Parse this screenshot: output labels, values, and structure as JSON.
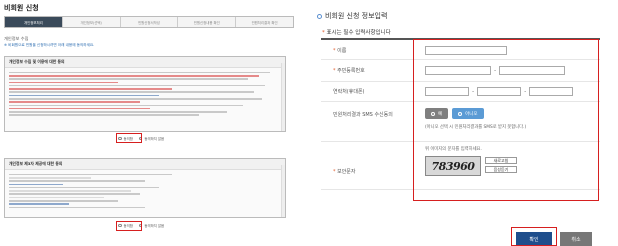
{
  "left": {
    "title": "비회원 신청",
    "tabs": [
      "개인정보처리",
      "개인정보(선택)",
      "민원신청서작성",
      "민원신청내용 확인",
      "민원처리결과 확인"
    ],
    "section_title": "개인정보 수집",
    "note": "※ 비회원으로 민원을 신청하시려면 아래 내용에 동의하세요.",
    "box1_head": "개인정보 수집 및 이용에 대한 동의",
    "box2_head": "개인정보 제3자 제공에 대한 동의",
    "agree1_label": "동의함",
    "disagree1_label": "동의하지 않음",
    "agree2_label": "동의함",
    "disagree2_label": "동의하지 않음"
  },
  "right": {
    "title": "비회원 신청 정보입력",
    "required_note": "표시는 필수 입력사항입니다",
    "fields": {
      "name": "이름",
      "rrn": "주민등록번호",
      "phone": "연락처(휴대폰)",
      "sms": "민원처리결과 SMS 수신동의",
      "captcha": "보안문자"
    },
    "sms_yes": "예",
    "sms_no": "아니오",
    "sms_desc": "(아니오 선택 시 민원처리결과를 SMS로 받지 못합니다.)",
    "captcha_desc": "위 이미지의 문자를 입력하세요.",
    "captcha_text": "783960",
    "captcha_refresh": "새로고침",
    "captcha_audio": "음성듣기",
    "confirm": "확인",
    "cancel": "취소"
  }
}
